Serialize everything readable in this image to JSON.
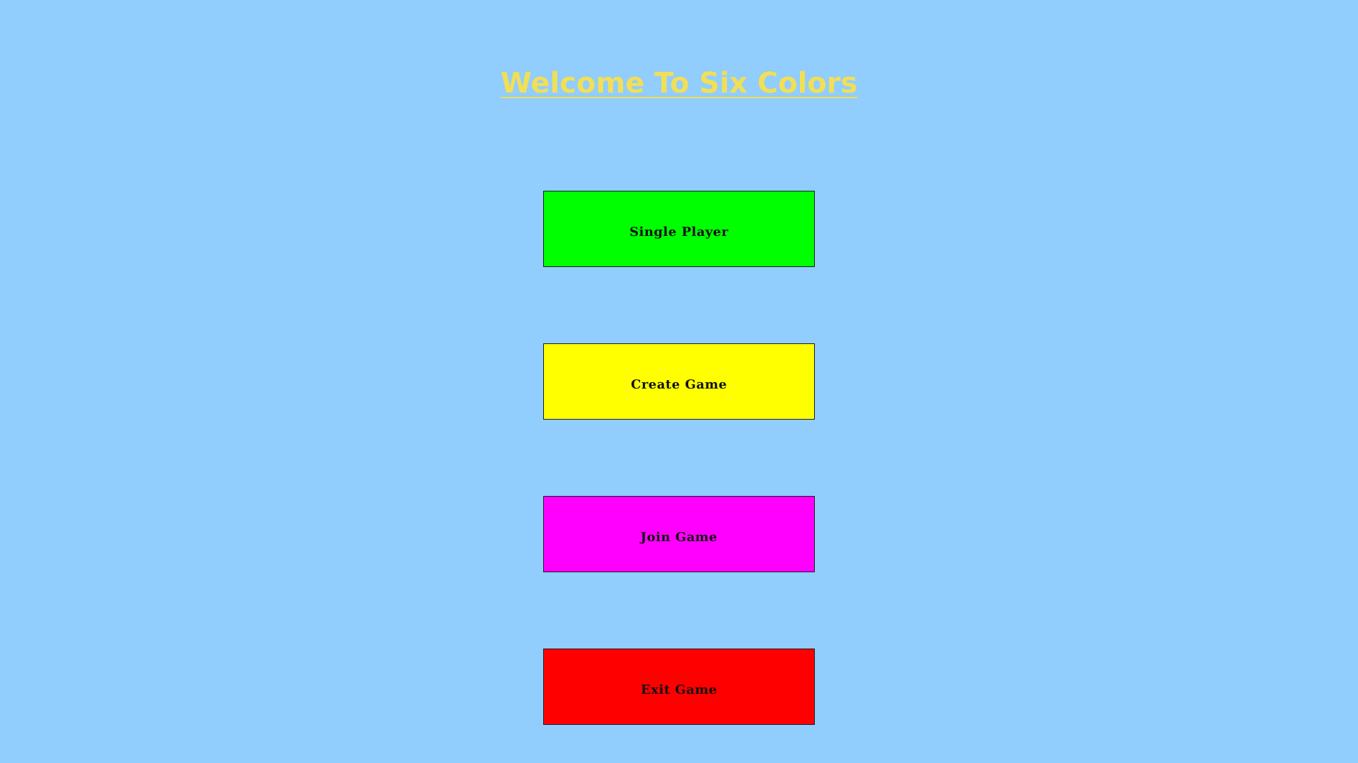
{
  "title": "Welcome To Six Colors",
  "colors": {
    "background": "#91cdfd",
    "title": "#f2df55"
  },
  "menu": {
    "single_player": {
      "label": "Single Player",
      "color": "#00ff00"
    },
    "create_game": {
      "label": "Create Game",
      "color": "#ffff00"
    },
    "join_game": {
      "label": "Join Game",
      "color": "#ff00ff"
    },
    "exit_game": {
      "label": "Exit Game",
      "color": "#ff0000"
    }
  }
}
